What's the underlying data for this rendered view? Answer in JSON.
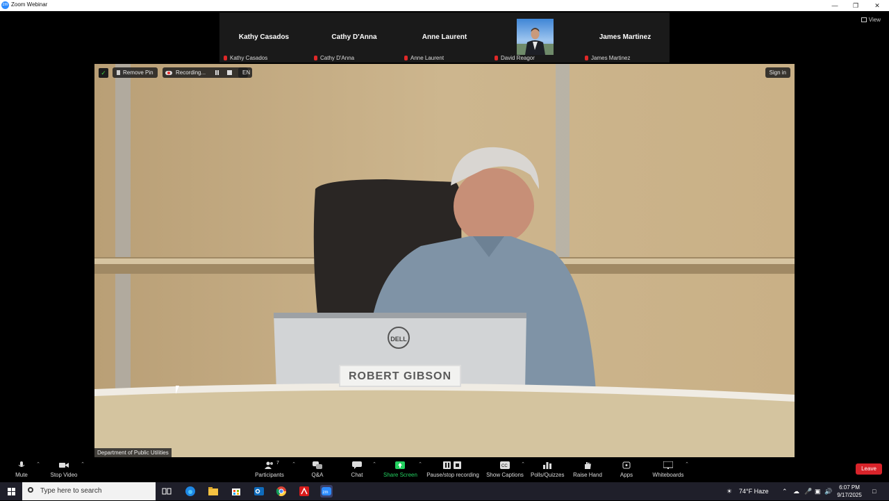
{
  "window": {
    "title": "Zoom Webinar",
    "app_icon": "zm",
    "controls": [
      "minimize-icon",
      "restore-icon",
      "close-icon"
    ]
  },
  "top_view": {
    "view_label": "View",
    "tiles": [
      {
        "big_name": "Kathy Casados",
        "label": "Kathy Casados",
        "muted": true
      },
      {
        "big_name": "Cathy D'Anna",
        "label": "Cathy D'Anna",
        "muted": true
      },
      {
        "big_name": "Anne Laurent",
        "label": "Anne Laurent",
        "muted": true
      },
      {
        "big_name": "",
        "label": "David Reagor",
        "muted": true,
        "has_photo": true
      },
      {
        "big_name": "James Martinez",
        "label": "James Martinez",
        "muted": true
      }
    ]
  },
  "main_video": {
    "remove_pin": "Remove Pin",
    "recording": "Recording...",
    "language": "EN",
    "sign_in": "Sign in",
    "nameplate": "ROBERT GIBSON",
    "monitor_brand": "DELL",
    "participant_label": "Department of Public Utilities"
  },
  "toolbar": {
    "mute": "Mute",
    "stop_video": "Stop Video",
    "participants": "Participants",
    "participants_count": "7",
    "qa": "Q&A",
    "chat": "Chat",
    "share_screen": "Share Screen",
    "pause_stop_recording": "Pause/stop recording",
    "show_captions": "Show Captions",
    "polls": "Polls/Quizzes",
    "raise_hand": "Raise Hand",
    "apps": "Apps",
    "whiteboards": "Whiteboards",
    "leave": "Leave",
    "colors": {
      "share": "#23d160",
      "leave": "#d8232a"
    }
  },
  "taskbar": {
    "search_placeholder": "Type here to search",
    "weather": "74°F  Haze",
    "time": "6:07 PM",
    "date": "9/17/2025",
    "apps": [
      "task-view-icon",
      "edge-icon",
      "file-explorer-icon",
      "store-icon",
      "outlook-icon",
      "chrome-icon",
      "acrobat-icon",
      "zoom-icon"
    ]
  }
}
